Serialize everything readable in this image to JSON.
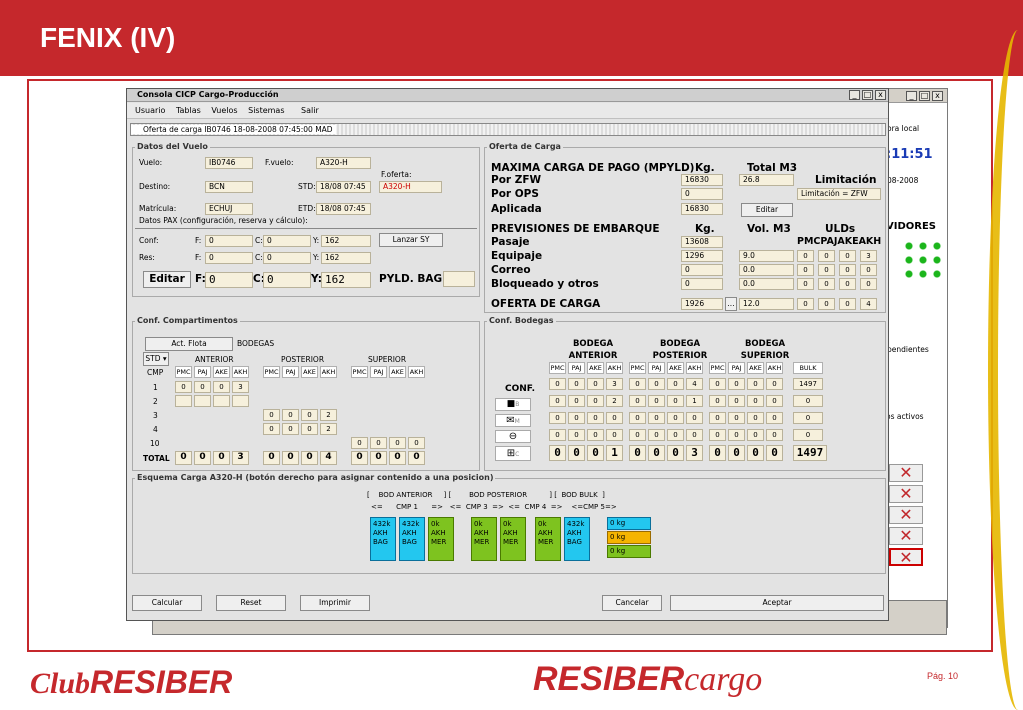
{
  "slide": {
    "title": "FENIX (IV)",
    "page": "Pág. 10",
    "logo_left_a": "Club",
    "logo_left_b": "RESIBER",
    "logo_mid_a": "RESIBER",
    "logo_mid_b": "cargo"
  },
  "bg": {
    "label_hora": "ora local",
    "time": ":11:51",
    "date": "08-2008",
    "servidores": "VIDORES",
    "pendientes": "pendientes",
    "activos": "os activos"
  },
  "window": {
    "title": "Consola CICP Cargo-Producción",
    "menu": [
      "Usuario",
      "Tablas",
      "Vuelos",
      "Sistemas",
      "Salir"
    ],
    "tab": "Oferta de carga IB0746 18-08-2008 07:45:00 MAD"
  },
  "datos_vuelo": {
    "group": "Datos del Vuelo",
    "vuelo_lbl": "Vuelo:",
    "vuelo": "IB0746",
    "fvuelo_lbl": "F.vuelo:",
    "fvuelo": "A320-H",
    "foferta_lbl": "F.oferta:",
    "foferta": "A320-H",
    "destino_lbl": "Destino:",
    "destino": "BCN",
    "std_lbl": "STD:",
    "std": "18/08 07:45",
    "matricula_lbl": "Matrícula:",
    "matricula": "ECHUJ",
    "etd_lbl": "ETD:",
    "etd": "18/08 07:45",
    "pax_lbl": "Datos PAX (configuración, reserva y cálculo):",
    "conf_lbl": "Conf:",
    "res_lbl": "Res:",
    "f_lbl": "F:",
    "c_lbl": "C:",
    "y_lbl": "Y:",
    "conf_f": "0",
    "conf_c": "0",
    "conf_y": "162",
    "res_f": "0",
    "res_c": "0",
    "res_y": "162",
    "lanzar": "Lanzar SY",
    "editar": "Editar",
    "tot_f": "0",
    "tot_c": "0",
    "tot_y": "162",
    "pyld_lbl": "PYLD. BAG:"
  },
  "oferta": {
    "group": "Oferta de Carga",
    "h_max": "MAXIMA CARGA DE PAGO (MPYLD)",
    "h_kg": "Kg.",
    "h_m3": "Total M3",
    "h_lim": "Limitación",
    "zfw_lbl": "Por ZFW",
    "zfw_kg": "16830",
    "zfw_m3": "26.8",
    "ops_lbl": "Por OPS",
    "ops_kg": "0",
    "ops_lim": "Limitación = ZFW",
    "apl_lbl": "Aplicada",
    "apl_kg": "16830",
    "editar": "Editar",
    "h_prev": "PREVISIONES DE EMBARQUE",
    "h_kg2": "Kg.",
    "h_vol": "Vol. M3",
    "h_ulds": "ULDs",
    "h_uldtypes": "PMCPAJAKEAKH",
    "pasaje_lbl": "Pasaje",
    "pasaje_kg": "13608",
    "equip_lbl": "Equipaje",
    "equip_kg": "1296",
    "equip_m3": "9.0",
    "equip_u": [
      "0",
      "0",
      "0",
      "3"
    ],
    "correo_lbl": "Correo",
    "correo_kg": "0",
    "correo_m3": "0.0",
    "correo_u": [
      "0",
      "0",
      "0",
      "0"
    ],
    "bloq_lbl": "Bloqueado y otros",
    "bloq_kg": "0",
    "bloq_m3": "0.0",
    "bloq_u": [
      "0",
      "0",
      "0",
      "0"
    ],
    "of_lbl": "OFERTA DE CARGA",
    "of_kg": "1926",
    "of_btn": "...",
    "of_m3": "12.0",
    "of_u": [
      "0",
      "0",
      "0",
      "4"
    ]
  },
  "compart": {
    "group": "Conf. Compartimentos",
    "act_flota": "Act. Flota",
    "bodegas": "BODEGAS",
    "std": "STD",
    "anterior": "ANTERIOR",
    "posterior": "POSTERIOR",
    "superior": "SUPERIOR",
    "cmp": "CMP",
    "types": [
      "PMC",
      "PAJ",
      "AKE",
      "AKH"
    ],
    "rows": [
      "1",
      "2",
      "3",
      "4",
      "10"
    ],
    "r1": [
      "0",
      "0",
      "0",
      "3"
    ],
    "r3": [
      "0",
      "0",
      "0",
      "2"
    ],
    "r4": [
      "0",
      "0",
      "0",
      "2"
    ],
    "r10": [
      "0",
      "0",
      "0",
      "0"
    ],
    "total": "TOTAL",
    "t_ant": [
      "0",
      "0",
      "0",
      "3"
    ],
    "t_pos": [
      "0",
      "0",
      "0",
      "4"
    ],
    "t_sup": [
      "0",
      "0",
      "0",
      "0"
    ]
  },
  "conf_bod": {
    "group": "Conf. Bodegas",
    "h_ant": "BODEGA ANTERIOR",
    "h_pos": "BODEGA POSTERIOR",
    "h_sup": "BODEGA SUPERIOR",
    "types": [
      "PMC",
      "PAJ",
      "AKE",
      "AKH"
    ],
    "bulk": "BULK",
    "conf": "CONF.",
    "r_conf": [
      "0",
      "0",
      "0",
      "3",
      "0",
      "0",
      "0",
      "4",
      "0",
      "0",
      "0",
      "0",
      "1497"
    ],
    "r_b": [
      "0",
      "0",
      "0",
      "2",
      "0",
      "0",
      "0",
      "1",
      "0",
      "0",
      "0",
      "0",
      "0"
    ],
    "r_m": [
      "0",
      "0",
      "0",
      "0",
      "0",
      "0",
      "0",
      "0",
      "0",
      "0",
      "0",
      "0",
      "0"
    ],
    "r_o": [
      "0",
      "0",
      "0",
      "0",
      "0",
      "0",
      "0",
      "0",
      "0",
      "0",
      "0",
      "0",
      "0"
    ],
    "r_c": [
      "0",
      "0",
      "0",
      "1",
      "0",
      "0",
      "0",
      "3",
      "0",
      "0",
      "0",
      "0",
      "1497"
    ],
    "b_lbl": "B",
    "m_lbl": "M",
    "c_lbl": "C"
  },
  "esquema": {
    "group": "Esquema Carga A320-H (botón derecho para asignar contenido a una posicion)",
    "top": "[    BOD ANTERIOR     ] [        BOD POSTERIOR          ] [  BOD BULK  ]",
    "mid": "<=      CMP 1      =>   <=  CMP 3  =>  <=  CMP 4  =>    <=CMP 5=>",
    "positions": [
      {
        "l1": "432k",
        "l2": "AKH",
        "l3": "BAG",
        "c": "cyan"
      },
      {
        "l1": "432k",
        "l2": "AKH",
        "l3": "BAG",
        "c": "cyan"
      },
      {
        "l1": "0k",
        "l2": "AKH",
        "l3": "MER",
        "c": "green"
      },
      {
        "l1": "0k",
        "l2": "AKH",
        "l3": "MER",
        "c": "green"
      },
      {
        "l1": "0k",
        "l2": "AKH",
        "l3": "MER",
        "c": "green"
      },
      {
        "l1": "0k",
        "l2": "AKH",
        "l3": "MER",
        "c": "green"
      },
      {
        "l1": "432k",
        "l2": "AKH",
        "l3": "BAG",
        "c": "cyan"
      }
    ],
    "bulk": [
      "0 kg",
      "0 kg",
      "0 kg"
    ]
  },
  "buttons": {
    "calcular": "Calcular",
    "reset": "Reset",
    "imprimir": "Imprimir",
    "cancelar": "Cancelar",
    "aceptar": "Aceptar"
  },
  "colors": {
    "brand_red": "#c5282c",
    "cyan": "#23c7ef",
    "green": "#7ec31f",
    "orange": "#f5b400"
  }
}
